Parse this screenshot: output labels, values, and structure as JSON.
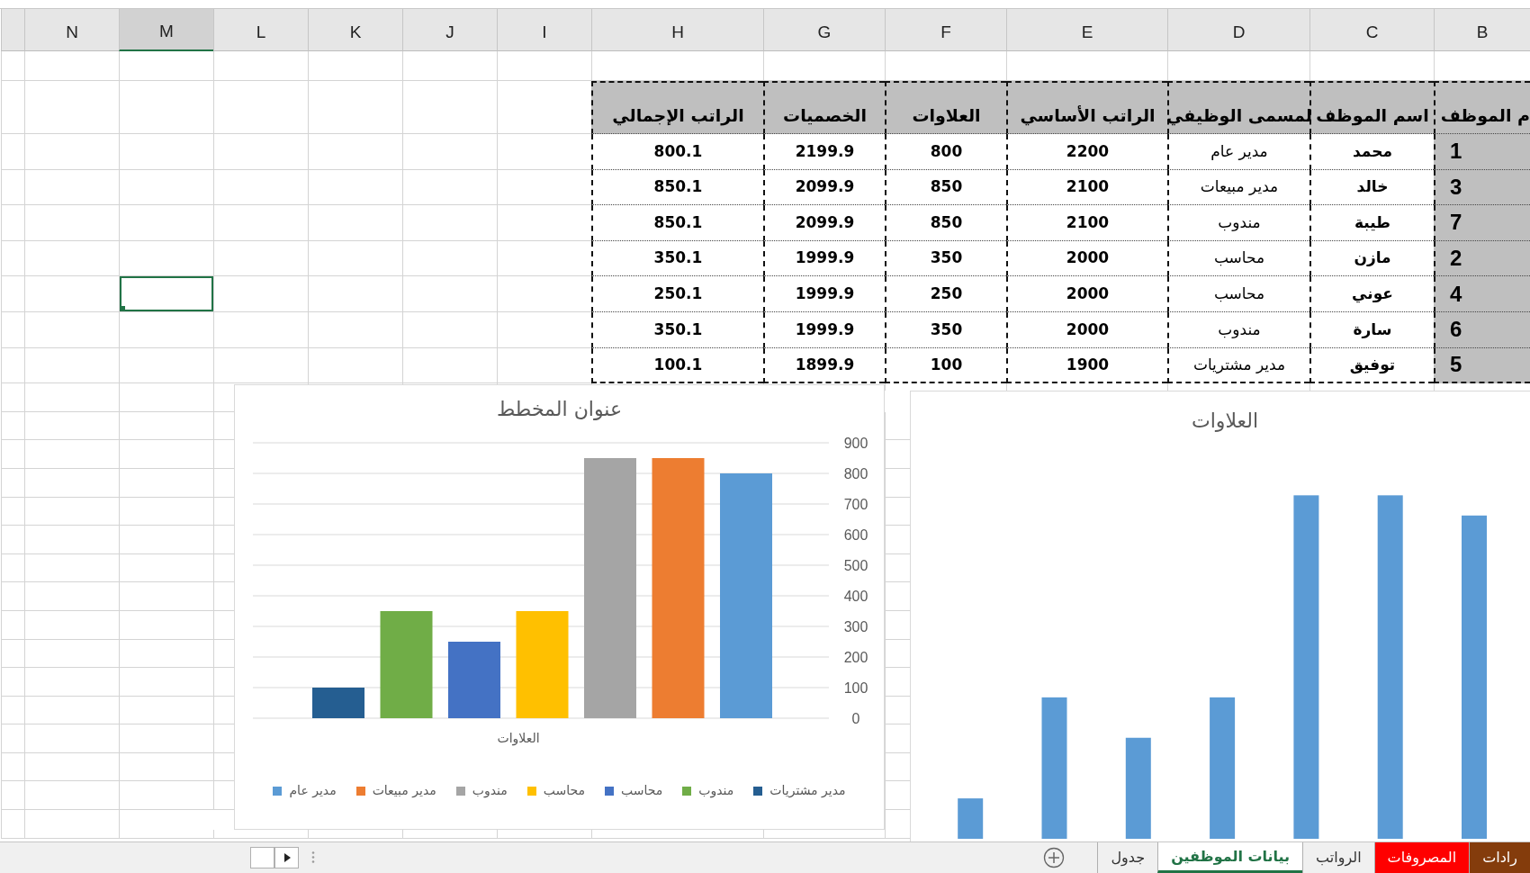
{
  "columns": [
    {
      "label": "B",
      "selected": false
    },
    {
      "label": "C",
      "selected": false
    },
    {
      "label": "D",
      "selected": false
    },
    {
      "label": "E",
      "selected": false
    },
    {
      "label": "F",
      "selected": false
    },
    {
      "label": "G",
      "selected": false
    },
    {
      "label": "H",
      "selected": false
    },
    {
      "label": "I",
      "selected": false
    },
    {
      "label": "J",
      "selected": false
    },
    {
      "label": "K",
      "selected": false
    },
    {
      "label": "L",
      "selected": false
    },
    {
      "label": "M",
      "selected": true
    },
    {
      "label": "N",
      "selected": false
    }
  ],
  "table": {
    "headers": [
      "م الموظف",
      "اسم الموظف",
      "لمسمى الوظيفي",
      "الراتب الأساسي",
      "العلاوات",
      "الخصميات",
      "الراتب الإجمالي"
    ],
    "rows": [
      {
        "cells": [
          "1",
          "محمد",
          "مدير عام",
          "2200",
          "800",
          "2199.9",
          "800.1"
        ],
        "active_cell": false
      },
      {
        "cells": [
          "3",
          "خالد",
          "مدير مبيعات",
          "2100",
          "850",
          "2099.9",
          "850.1"
        ],
        "active_cell": false
      },
      {
        "cells": [
          "7",
          "طيبة",
          "مندوب",
          "2100",
          "850",
          "2099.9",
          "850.1"
        ],
        "active_cell": false
      },
      {
        "cells": [
          "2",
          "مازن",
          "محاسب",
          "2000",
          "350",
          "1999.9",
          "350.1"
        ],
        "active_cell": false
      },
      {
        "cells": [
          "4",
          "عوني",
          "محاسب",
          "2000",
          "250",
          "1999.9",
          "250.1"
        ],
        "active_cell": true
      },
      {
        "cells": [
          "6",
          "سارة",
          "مندوب",
          "2000",
          "350",
          "1999.9",
          "350.1"
        ],
        "active_cell": false
      },
      {
        "cells": [
          "5",
          "توفيق",
          "مدير مشتريات",
          "1900",
          "100",
          "1899.9",
          "100.1"
        ],
        "active_cell": false
      }
    ]
  },
  "allowance_chart": {
    "chart_data": {
      "type": "bar",
      "title": "عنوان المخطط",
      "categories": [
        "العلاوات"
      ],
      "series": [
        {
          "name": "مدير عام",
          "color": "#5b9bd5",
          "values": [
            800
          ]
        },
        {
          "name": "مدير مبيعات",
          "color": "#ed7d31",
          "values": [
            850
          ]
        },
        {
          "name": "مندوب",
          "color": "#a5a5a5",
          "values": [
            850
          ]
        },
        {
          "name": "محاسب",
          "color": "#ffc000",
          "values": [
            350
          ]
        },
        {
          "name": "محاسب",
          "color": "#4472c4",
          "values": [
            250
          ]
        },
        {
          "name": "مندوب",
          "color": "#70ad47",
          "values": [
            350
          ]
        },
        {
          "name": "مدير مشتريات",
          "color": "#255e91",
          "values": [
            100
          ]
        }
      ],
      "grid": true,
      "legend": true,
      "ylim": [
        0,
        900
      ],
      "yticks": [
        0,
        100,
        200,
        300,
        400,
        500,
        600,
        700,
        800,
        900
      ]
    }
  },
  "second_chart": {
    "title": "العلاوات"
  },
  "sheet_tabs": [
    {
      "label": "رادات",
      "color": "#843c0c",
      "selected": false
    },
    {
      "label": "المصروفات",
      "color": "#ff0000",
      "selected": false
    },
    {
      "label": "الرواتب",
      "selected": false
    },
    {
      "label": "بيانات الموظفين",
      "selected": true
    },
    {
      "label": "جدول",
      "selected": false
    }
  ]
}
